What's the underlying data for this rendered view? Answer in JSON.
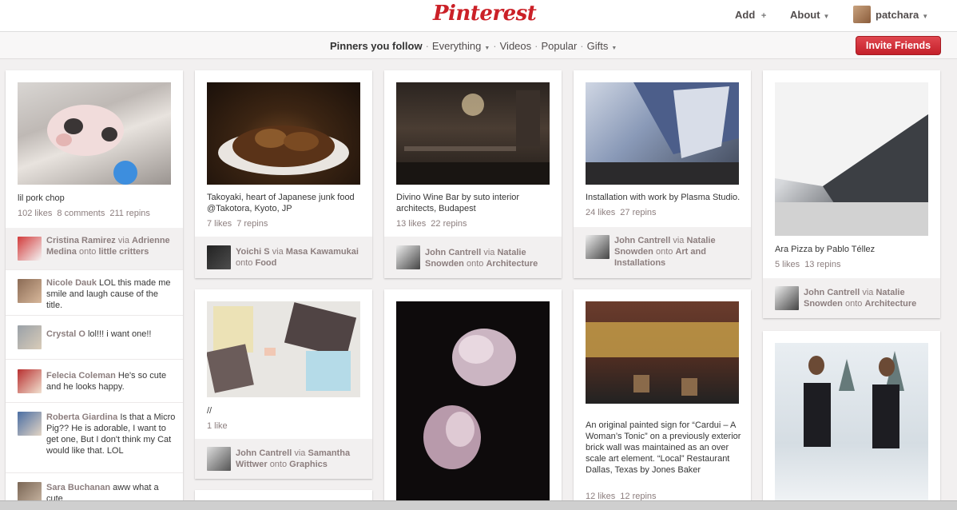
{
  "header": {
    "logo": "Pinterest",
    "add_label": "Add",
    "add_icon": "+",
    "about_label": "About",
    "username": "patchara"
  },
  "subnav": {
    "pinners": "Pinners you follow",
    "everything": "Everything",
    "videos": "Videos",
    "popular": "Popular",
    "gifts": "Gifts",
    "invite": "Invite Friends"
  },
  "pins": [
    {
      "desc": "lil pork chop",
      "likes": "102 likes",
      "comments": "8 comments",
      "repins": "211 repins",
      "user": "Cristina Ramirez",
      "via": "Adrienne Medina",
      "board": "little critters"
    },
    {
      "desc": "Takoyaki, heart of Japanese junk food @Takotora, Kyoto, JP",
      "likes": "7 likes",
      "repins": "7 repins",
      "user": "Yoichi S",
      "via": "Masa Kawamukai",
      "board": "Food"
    },
    {
      "desc": "Divino Wine Bar by suto interior architects, Budapest",
      "likes": "13 likes",
      "repins": "22 repins",
      "user": "John Cantrell",
      "via": "Natalie Snowden",
      "board": "Architecture"
    },
    {
      "desc": "Installation with work by Plasma Studio.",
      "likes": "24 likes",
      "repins": "27 repins",
      "user": "John Cantrell",
      "via": "Natalie Snowden",
      "board": "Art and Installations"
    },
    {
      "desc": "Ara Pizza by Pablo Téllez",
      "likes": "5 likes",
      "repins": "13 repins",
      "user": "John Cantrell",
      "via": "Natalie Snowden",
      "board": "Architecture"
    },
    {
      "desc": "//",
      "likes": "1 like",
      "user": "John Cantrell",
      "via": "Samantha Wittwer",
      "board": "Graphics"
    },
    {
      "desc": "An original painted sign for “Cardui – A Woman’s Tonic” on a previously exterior brick wall was maintained as an over scale art element. “Local” Restaurant Dallas, Texas by Jones Baker",
      "likes": "12 likes",
      "repins": "12 repins"
    }
  ],
  "comments": [
    {
      "user": "Nicole Dauk",
      "text": "LOL this made me smile and laugh cause of the title."
    },
    {
      "user": "Crystal O",
      "text": "lol!!! i want one!!"
    },
    {
      "user": "Felecia Coleman",
      "text": "He's so cute and he looks happy."
    },
    {
      "user": "Roberta Giardina",
      "text": "Is that a Micro Pig?? He is adorable, I want to get one, But I don't think my Cat would like that. LOL"
    },
    {
      "user": "Sara Buchanan",
      "text": "aww what a cute"
    }
  ],
  "words": {
    "via": "via",
    "onto": "onto"
  },
  "colors": {
    "brand": "#cb2027",
    "muted": "#8c7e7e",
    "background": "#f2f0f0"
  }
}
